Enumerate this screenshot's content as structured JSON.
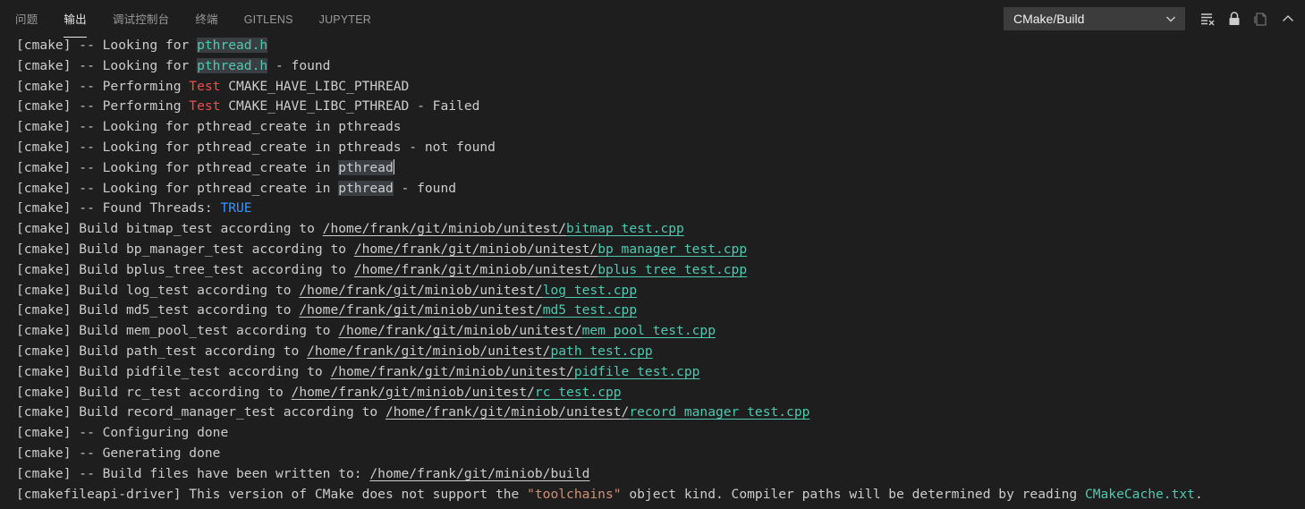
{
  "tabs": [
    {
      "label": "问题",
      "active": false
    },
    {
      "label": "输出",
      "active": true
    },
    {
      "label": "调试控制台",
      "active": false
    },
    {
      "label": "终端",
      "active": false
    },
    {
      "label": "GITLENS",
      "active": false
    },
    {
      "label": "JUPYTER",
      "active": false
    }
  ],
  "toolbar": {
    "channel_select": "CMake/Build",
    "icons": [
      "clear-output-icon",
      "lock-scroll-icon",
      "open-in-editor-icon",
      "maximize-panel-icon"
    ]
  },
  "colors": {
    "background": "#1e1e1e",
    "text": "#cccccc",
    "link": "#4ec9b0",
    "error_keyword": "#f14c4c",
    "boolean": "#3794ff",
    "string": "#ce9178"
  },
  "output_lines": [
    [
      {
        "t": "[cmake] -- Looking for "
      },
      {
        "t": "pthread.h",
        "s": "link hl"
      }
    ],
    [
      {
        "t": "[cmake] -- Looking for "
      },
      {
        "t": "pthread.h",
        "s": "link hl"
      },
      {
        "t": " - found"
      }
    ],
    [
      {
        "t": "[cmake] -- Performing "
      },
      {
        "t": "Test",
        "s": "red"
      },
      {
        "t": " CMAKE_HAVE_LIBC_PTHREAD"
      }
    ],
    [
      {
        "t": "[cmake] -- Performing "
      },
      {
        "t": "Test",
        "s": "red"
      },
      {
        "t": " CMAKE_HAVE_LIBC_PTHREAD - Failed"
      }
    ],
    [
      {
        "t": "[cmake] -- Looking for pthread_create in pthreads"
      }
    ],
    [
      {
        "t": "[cmake] -- Looking for pthread_create in pthreads - not found"
      }
    ],
    [
      {
        "t": "[cmake] -- Looking for pthread_create in "
      },
      {
        "t": "pthread",
        "s": "hl"
      },
      {
        "t": "",
        "s": "cursor"
      }
    ],
    [
      {
        "t": "[cmake] -- Looking for pthread_create in "
      },
      {
        "t": "pthread",
        "s": "hl"
      },
      {
        "t": " - found"
      }
    ],
    [
      {
        "t": "[cmake] -- Found Threads: "
      },
      {
        "t": "TRUE",
        "s": "blue"
      }
    ],
    [
      {
        "t": "[cmake] Build bitmap_test according to "
      },
      {
        "t": "/home/frank/git/miniob/unitest/",
        "s": "u"
      },
      {
        "t": "bitmap_test.cpp",
        "s": "link u"
      }
    ],
    [
      {
        "t": "[cmake] Build bp_manager_test according to "
      },
      {
        "t": "/home/frank/git/miniob/unitest/",
        "s": "u"
      },
      {
        "t": "bp_manager_test.cpp",
        "s": "link u"
      }
    ],
    [
      {
        "t": "[cmake] Build bplus_tree_test according to "
      },
      {
        "t": "/home/frank/git/miniob/unitest/",
        "s": "u"
      },
      {
        "t": "bplus_tree_test.cpp",
        "s": "link u"
      }
    ],
    [
      {
        "t": "[cmake] Build log_test according to "
      },
      {
        "t": "/home/frank/git/miniob/unitest/",
        "s": "u"
      },
      {
        "t": "log_test.cpp",
        "s": "link u"
      }
    ],
    [
      {
        "t": "[cmake] Build md5_test according to "
      },
      {
        "t": "/home/frank/git/miniob/unitest/",
        "s": "u"
      },
      {
        "t": "md5_test.cpp",
        "s": "link u"
      }
    ],
    [
      {
        "t": "[cmake] Build mem_pool_test according to "
      },
      {
        "t": "/home/frank/git/miniob/unitest/",
        "s": "u"
      },
      {
        "t": "mem_pool_test.cpp",
        "s": "link u"
      }
    ],
    [
      {
        "t": "[cmake] Build path_test according to "
      },
      {
        "t": "/home/frank/git/miniob/unitest/",
        "s": "u"
      },
      {
        "t": "path_test.cpp",
        "s": "link u"
      }
    ],
    [
      {
        "t": "[cmake] Build pidfile_test according to "
      },
      {
        "t": "/home/frank/git/miniob/unitest/",
        "s": "u"
      },
      {
        "t": "pidfile_test.cpp",
        "s": "link u"
      }
    ],
    [
      {
        "t": "[cmake] Build rc_test according to "
      },
      {
        "t": "/home/frank/git/miniob/unitest/",
        "s": "u"
      },
      {
        "t": "rc_test.cpp",
        "s": "link u"
      }
    ],
    [
      {
        "t": "[cmake] Build record_manager_test according to "
      },
      {
        "t": "/home/frank/git/miniob/unitest/",
        "s": "u"
      },
      {
        "t": "record_manager_test.cpp",
        "s": "link u"
      }
    ],
    [
      {
        "t": "[cmake] -- Configuring done"
      }
    ],
    [
      {
        "t": "[cmake] -- Generating done"
      }
    ],
    [
      {
        "t": "[cmake] -- Build files have been written to: "
      },
      {
        "t": "/home/frank/git/miniob/build",
        "s": "u"
      }
    ],
    [
      {
        "t": "[cmakefileapi-driver] This version of CMake does not support the "
      },
      {
        "t": "\"toolchains\"",
        "s": "orange"
      },
      {
        "t": " object kind. Compiler paths will be determined by reading "
      },
      {
        "t": "CMakeCache.txt",
        "s": "link"
      },
      {
        "t": "."
      }
    ]
  ]
}
